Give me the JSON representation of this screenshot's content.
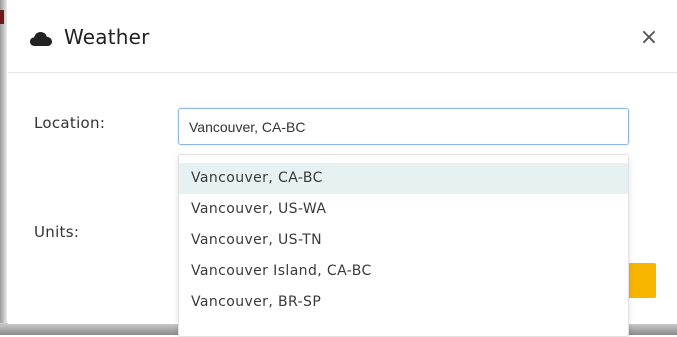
{
  "dialog": {
    "title": "Weather",
    "icon": "cloud-icon",
    "close_symbol": "×"
  },
  "form": {
    "location_label": "Location:",
    "units_label": "Units:",
    "location_value": "Vancouver, CA-BC"
  },
  "dropdown": {
    "items": [
      {
        "label": "Vancouver, CA-BC",
        "active": true
      },
      {
        "label": "Vancouver, US-WA",
        "active": false
      },
      {
        "label": "Vancouver, US-TN",
        "active": false
      },
      {
        "label": "Vancouver Island, CA-BC",
        "active": false
      },
      {
        "label": "Vancouver, BR-SP",
        "active": false
      }
    ]
  },
  "colors": {
    "highlight": "#e6f1f2",
    "accent_button": "#f7b500",
    "input_border": "#8fb7e6"
  }
}
